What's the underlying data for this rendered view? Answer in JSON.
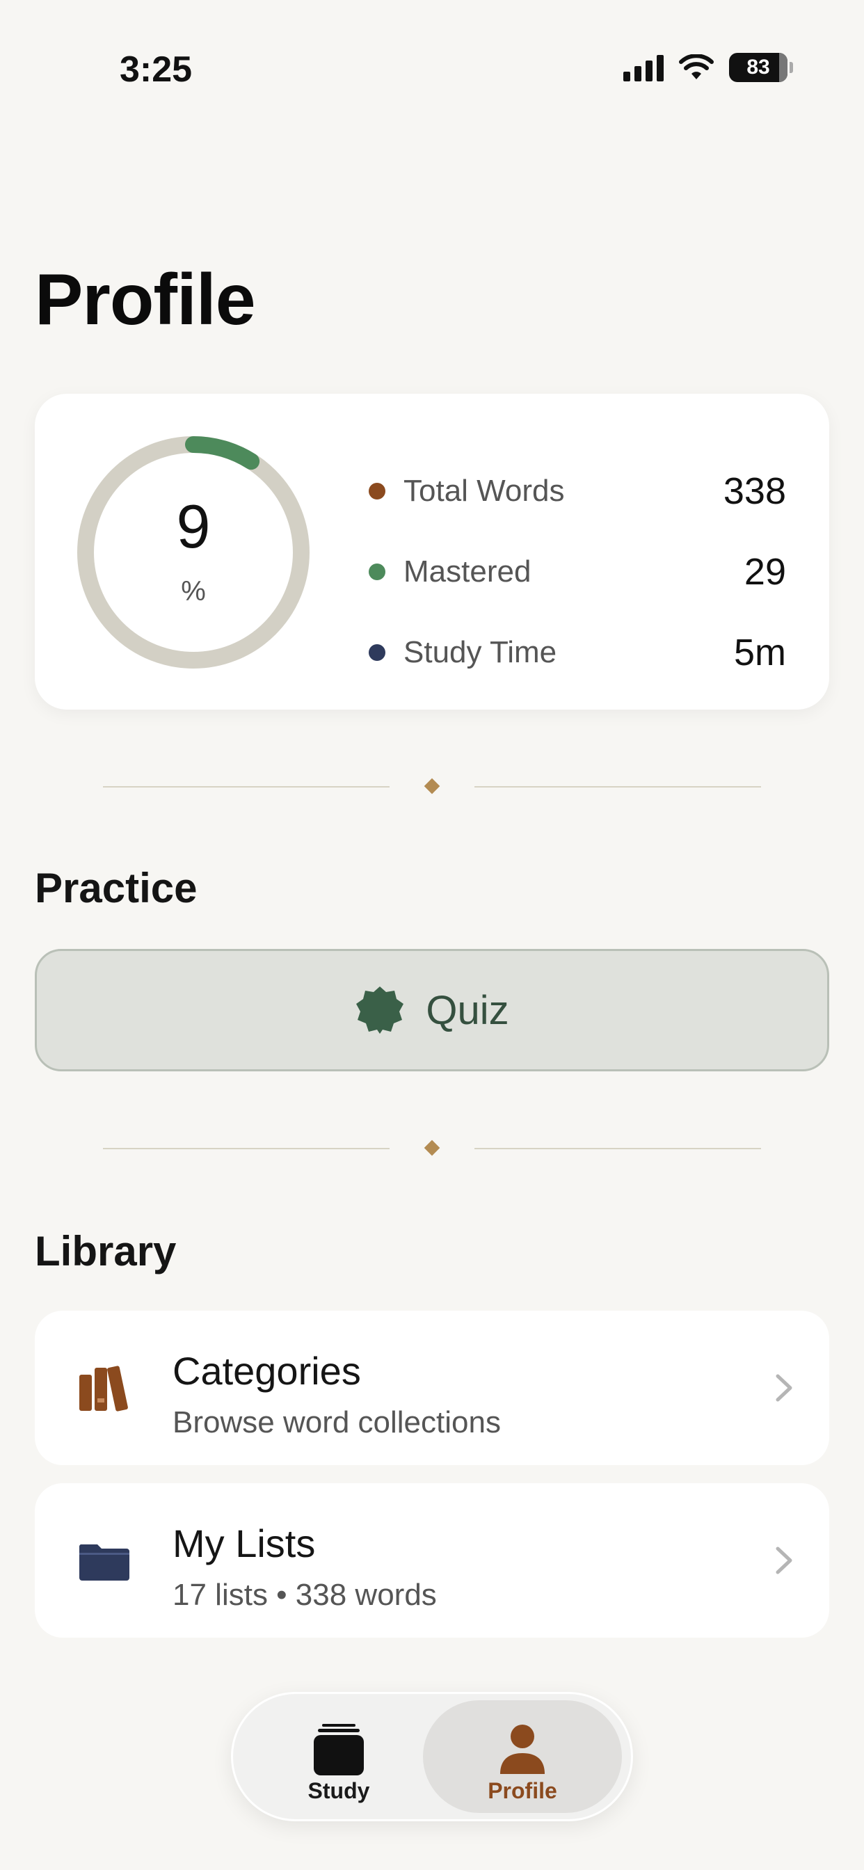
{
  "status_bar": {
    "time": "3:25",
    "battery": "83"
  },
  "page": {
    "title": "Profile"
  },
  "stats": {
    "progress_value": "9",
    "progress_unit": "%",
    "progress_fraction": 0.09,
    "rows": [
      {
        "label": "Total Words",
        "value": "338",
        "color": "#8b4a1e"
      },
      {
        "label": "Mastered",
        "value": "29",
        "color": "#4d8a5b"
      },
      {
        "label": "Study Time",
        "value": "5m",
        "color": "#2e3a5c"
      }
    ]
  },
  "practice": {
    "section_title": "Practice",
    "quiz_label": "Quiz",
    "quiz_icon": "badge-icon"
  },
  "library": {
    "section_title": "Library",
    "items": [
      {
        "title": "Categories",
        "subtitle": "Browse word collections",
        "icon": "books-icon"
      },
      {
        "title": "My Lists",
        "subtitle": "17 lists • 338 words",
        "icon": "folder-icon"
      }
    ]
  },
  "tabs": [
    {
      "label": "Study",
      "icon": "cards-stack-icon",
      "selected": false
    },
    {
      "label": "Profile",
      "icon": "person-icon",
      "selected": true
    }
  ],
  "colors": {
    "background": "#f7f6f3",
    "accent_brown": "#8b4a1e",
    "accent_green": "#4d8a5b",
    "navy": "#2e3a5c",
    "quiz_text": "#35503f"
  }
}
